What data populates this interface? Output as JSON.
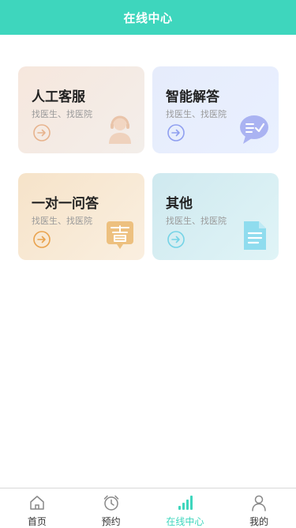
{
  "header": {
    "title": "在线中心"
  },
  "cards": [
    {
      "title": "人工客服",
      "subtitle": "找医生、找医院",
      "icon": "headset-agent-icon",
      "accent": "#e7b38d"
    },
    {
      "title": "智能解答",
      "subtitle": "找医生、找医院",
      "icon": "chat-bubble-icon",
      "accent": "#8f9ff0"
    },
    {
      "title": "一对一问答",
      "subtitle": "找医生、找医院",
      "icon": "answer-badge-icon",
      "accent": "#e9a24d"
    },
    {
      "title": "其他",
      "subtitle": "找医生、找医院",
      "icon": "document-icon",
      "accent": "#74d3e6"
    }
  ],
  "tabbar": {
    "items": [
      {
        "label": "首页",
        "icon": "home-icon",
        "active": false
      },
      {
        "label": "预约",
        "icon": "alarm-clock-icon",
        "active": false
      },
      {
        "label": "在线中心",
        "icon": "signal-bars-icon",
        "active": true
      },
      {
        "label": "我的",
        "icon": "person-icon",
        "active": false
      }
    ]
  },
  "colors": {
    "brand": "#3ed6bd",
    "inactive_tab": "#888888"
  }
}
